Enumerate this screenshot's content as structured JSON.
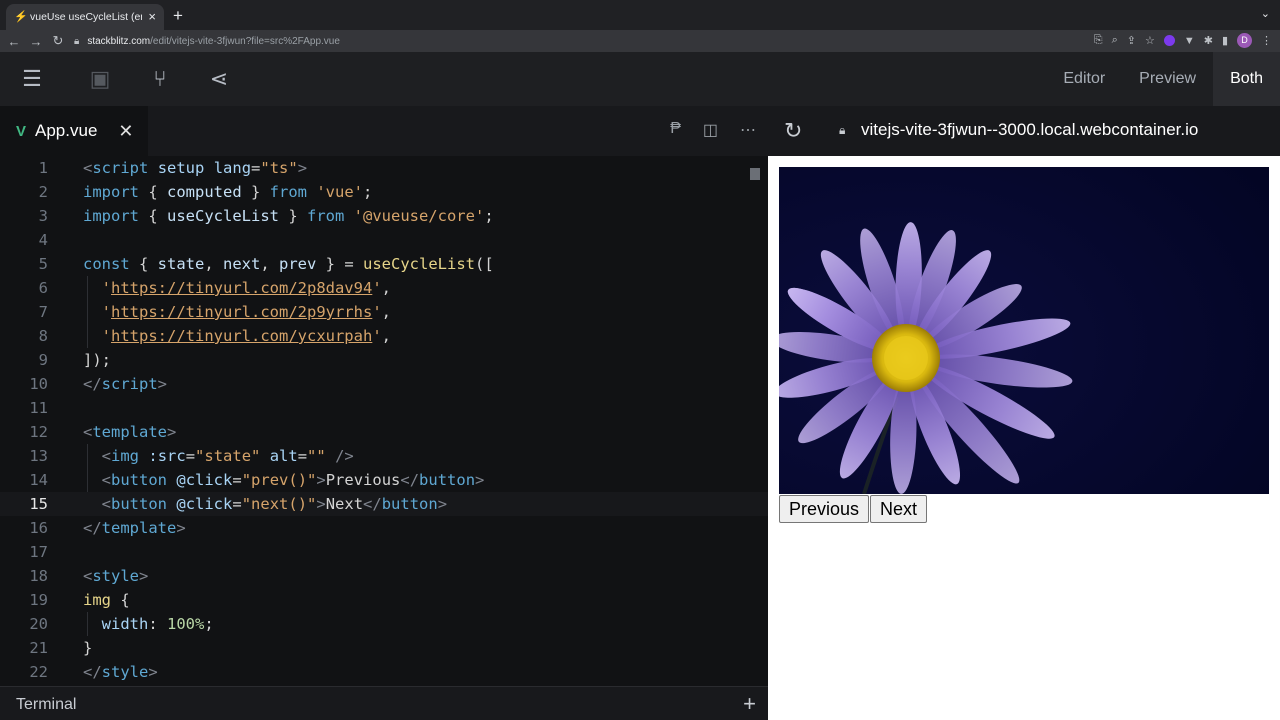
{
  "browser": {
    "tab_title": "vueUse useCycleList (end actio",
    "url_host": "stackblitz.com",
    "url_path": "/edit/vitejs-vite-3fjwun?file=src%2FApp.vue"
  },
  "toolbar": {
    "views": [
      "Editor",
      "Preview",
      "Both"
    ],
    "active_view": "Both"
  },
  "editor": {
    "file_tab": "App.vue",
    "current_line": 15
  },
  "preview": {
    "url": "vitejs-vite-3fjwun--3000.local.webcontainer.io",
    "previous_label": "Previous",
    "next_label": "Next"
  },
  "terminal": {
    "label": "Terminal"
  },
  "code_lines": [
    {
      "n": "1",
      "parts": [
        [
          "t",
          "<"
        ],
        [
          "tag",
          "script"
        ],
        [
          "p",
          " "
        ],
        [
          "at",
          "setup"
        ],
        [
          "p",
          " "
        ],
        [
          "at",
          "lang"
        ],
        [
          "p",
          "="
        ],
        [
          "s",
          "\"ts\""
        ],
        [
          "t",
          ">"
        ]
      ]
    },
    {
      "n": "2",
      "parts": [
        [
          "kw",
          "import"
        ],
        [
          "p",
          " { "
        ],
        [
          "id",
          "computed"
        ],
        [
          "p",
          " } "
        ],
        [
          "kw",
          "from"
        ],
        [
          "p",
          " "
        ],
        [
          "s",
          "'vue'"
        ],
        [
          "p",
          ";"
        ]
      ]
    },
    {
      "n": "3",
      "parts": [
        [
          "kw",
          "import"
        ],
        [
          "p",
          " { "
        ],
        [
          "id",
          "useCycleList"
        ],
        [
          "p",
          " } "
        ],
        [
          "kw",
          "from"
        ],
        [
          "p",
          " "
        ],
        [
          "s",
          "'@vueuse/core'"
        ],
        [
          "p",
          ";"
        ]
      ]
    },
    {
      "n": "4",
      "parts": []
    },
    {
      "n": "5",
      "parts": [
        [
          "kw",
          "const"
        ],
        [
          "p",
          " { "
        ],
        [
          "id",
          "state"
        ],
        [
          "p",
          ", "
        ],
        [
          "id",
          "next"
        ],
        [
          "p",
          ", "
        ],
        [
          "id",
          "prev"
        ],
        [
          "p",
          " } = "
        ],
        [
          "fn",
          "useCycleList"
        ],
        [
          "p",
          "(["
        ]
      ]
    },
    {
      "n": "6",
      "parts": [
        [
          "p",
          "  "
        ],
        [
          "s",
          "'"
        ],
        [
          "u",
          "https://tinyurl.com/2p8dav94"
        ],
        [
          "s",
          "'"
        ],
        [
          "p",
          ","
        ]
      ]
    },
    {
      "n": "7",
      "parts": [
        [
          "p",
          "  "
        ],
        [
          "s",
          "'"
        ],
        [
          "u",
          "https://tinyurl.com/2p9yrrhs"
        ],
        [
          "s",
          "'"
        ],
        [
          "p",
          ","
        ]
      ]
    },
    {
      "n": "8",
      "parts": [
        [
          "p",
          "  "
        ],
        [
          "s",
          "'"
        ],
        [
          "u",
          "https://tinyurl.com/ycxurpah"
        ],
        [
          "s",
          "'"
        ],
        [
          "p",
          ","
        ]
      ]
    },
    {
      "n": "9",
      "parts": [
        [
          "p",
          "]);"
        ]
      ]
    },
    {
      "n": "10",
      "parts": [
        [
          "t",
          "</"
        ],
        [
          "tag",
          "script"
        ],
        [
          "t",
          ">"
        ]
      ]
    },
    {
      "n": "11",
      "parts": []
    },
    {
      "n": "12",
      "parts": [
        [
          "t",
          "<"
        ],
        [
          "tag",
          "template"
        ],
        [
          "t",
          ">"
        ]
      ]
    },
    {
      "n": "13",
      "parts": [
        [
          "p",
          "  "
        ],
        [
          "t",
          "<"
        ],
        [
          "tag",
          "img"
        ],
        [
          "p",
          " "
        ],
        [
          "at",
          ":src"
        ],
        [
          "p",
          "="
        ],
        [
          "s",
          "\"state\""
        ],
        [
          "p",
          " "
        ],
        [
          "at",
          "alt"
        ],
        [
          "p",
          "="
        ],
        [
          "s",
          "\"\""
        ],
        [
          "p",
          " "
        ],
        [
          "t",
          "/>"
        ]
      ]
    },
    {
      "n": "14",
      "parts": [
        [
          "p",
          "  "
        ],
        [
          "t",
          "<"
        ],
        [
          "tag",
          "button"
        ],
        [
          "p",
          " "
        ],
        [
          "at",
          "@click"
        ],
        [
          "p",
          "="
        ],
        [
          "s",
          "\"prev()\""
        ],
        [
          "t",
          ">"
        ],
        [
          "p",
          "Previous"
        ],
        [
          "t",
          "</"
        ],
        [
          "tag",
          "button"
        ],
        [
          "t",
          ">"
        ]
      ]
    },
    {
      "n": "15",
      "parts": [
        [
          "p",
          "  "
        ],
        [
          "t",
          "<"
        ],
        [
          "tag",
          "button"
        ],
        [
          "p",
          " "
        ],
        [
          "at",
          "@click"
        ],
        [
          "p",
          "="
        ],
        [
          "s",
          "\"next()\""
        ],
        [
          "t",
          ">"
        ],
        [
          "p",
          "Next"
        ],
        [
          "t",
          "</"
        ],
        [
          "tag",
          "button"
        ],
        [
          "t",
          ">"
        ]
      ]
    },
    {
      "n": "16",
      "parts": [
        [
          "t",
          "</"
        ],
        [
          "tag",
          "template"
        ],
        [
          "t",
          ">"
        ]
      ]
    },
    {
      "n": "17",
      "parts": []
    },
    {
      "n": "18",
      "parts": [
        [
          "t",
          "<"
        ],
        [
          "tag",
          "style"
        ],
        [
          "t",
          ">"
        ]
      ]
    },
    {
      "n": "19",
      "parts": [
        [
          "fn",
          "img"
        ],
        [
          "p",
          " {"
        ]
      ]
    },
    {
      "n": "20",
      "parts": [
        [
          "p",
          "  "
        ],
        [
          "at",
          "width"
        ],
        [
          "p",
          ": "
        ],
        [
          "num",
          "100%"
        ],
        [
          "p",
          ";"
        ]
      ]
    },
    {
      "n": "21",
      "parts": [
        [
          "p",
          "}"
        ]
      ]
    },
    {
      "n": "22",
      "parts": [
        [
          "t",
          "</"
        ],
        [
          "tag",
          "style"
        ],
        [
          "t",
          ">"
        ]
      ]
    }
  ]
}
